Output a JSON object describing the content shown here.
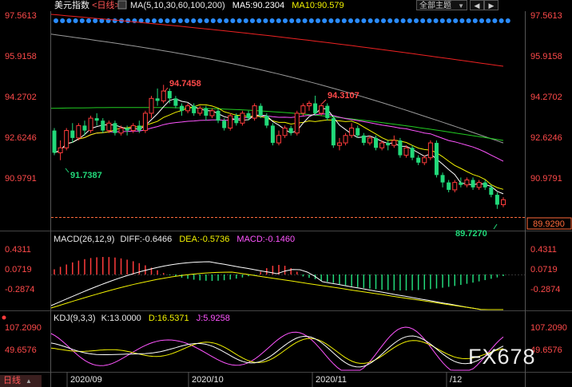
{
  "header": {
    "symbol": "美元指数",
    "period": "<日线>",
    "ma_params": "MA(5,10,30,60,100,200)",
    "ma5": "MA5:90.2304",
    "ma10": "MA10:90.579",
    "all_indicators": "全部主题",
    "nav_prev": "◀",
    "nav_next": "▶"
  },
  "colors": {
    "up": "#ff3b3b",
    "down": "#22d97a",
    "ma5": "#ffffff",
    "ma10": "#f2f200",
    "ma30": "#ff55ff",
    "ma60": "#22cc22",
    "ma100": "#9a9a9a",
    "ma200": "#ee2222"
  },
  "price_axis": {
    "left_labels": [
      "97.5613",
      "95.9158",
      "94.2702",
      "92.6246",
      "90.9791"
    ],
    "right_labels": [
      "97.5613",
      "95.9158",
      "94.2702",
      "92.6246",
      "90.9791"
    ],
    "current_price": "89.9290"
  },
  "annotations": {
    "high_1": "94.7458",
    "high_2": "94.3107",
    "low_1": "91.7387",
    "low_2": "89.7270"
  },
  "macd": {
    "title": "MACD(26,12,9)",
    "diff": "DIFF:-0.6466",
    "dea": "DEA:-0.5736",
    "macd": "MACD:-0.1460",
    "axis_labels": [
      "0.4311",
      "0.0719",
      "-0.2874"
    ]
  },
  "kdj": {
    "title": "KDJ(9,3,3)",
    "k": "K:13.0000",
    "d": "D:16.5371",
    "j": "J:5.9258",
    "axis_labels": [
      "107.2090",
      "49.6576"
    ]
  },
  "time_axis": {
    "labels": [
      "2020/09",
      "2020/10",
      "2020/11",
      "/12"
    ]
  },
  "footer": {
    "period_tab": "日线"
  },
  "watermark": "FX678",
  "chart_data": {
    "type": "candlestick",
    "price_range": [
      89.4,
      97.6
    ],
    "series": [
      {
        "name": "MA5",
        "value": 90.2304
      },
      {
        "name": "MA10",
        "value": 90.579
      }
    ],
    "candles": [
      [
        92.9,
        92.0,
        93.0,
        91.9
      ],
      [
        92.0,
        92.2,
        92.5,
        91.7
      ],
      [
        92.2,
        92.9,
        93.0,
        92.1
      ],
      [
        92.9,
        92.6,
        93.2,
        92.4
      ],
      [
        92.6,
        93.1,
        93.2,
        92.5
      ],
      [
        93.1,
        92.9,
        93.3,
        92.7
      ],
      [
        92.9,
        93.4,
        93.5,
        92.8
      ],
      [
        93.4,
        93.3,
        93.6,
        93.1
      ],
      [
        93.3,
        92.9,
        93.4,
        92.8
      ],
      [
        92.9,
        93.2,
        93.3,
        92.8
      ],
      [
        93.2,
        92.8,
        93.3,
        92.7
      ],
      [
        92.8,
        93.0,
        93.1,
        92.7
      ],
      [
        93.0,
        92.9,
        93.1,
        92.7
      ],
      [
        92.9,
        93.1,
        93.2,
        92.8
      ],
      [
        93.1,
        92.9,
        93.3,
        92.8
      ],
      [
        92.9,
        93.6,
        93.7,
        92.8
      ],
      [
        93.6,
        94.2,
        94.3,
        93.4
      ],
      [
        94.2,
        94.1,
        94.6,
        93.9
      ],
      [
        94.1,
        94.5,
        94.75,
        94.0
      ],
      [
        94.5,
        94.2,
        94.6,
        94.0
      ],
      [
        94.2,
        93.9,
        94.3,
        93.8
      ],
      [
        93.9,
        93.7,
        94.0,
        93.5
      ],
      [
        93.7,
        93.9,
        94.0,
        93.6
      ],
      [
        93.9,
        93.6,
        94.0,
        93.5
      ],
      [
        93.6,
        93.8,
        93.9,
        93.5
      ],
      [
        93.8,
        93.5,
        93.9,
        93.3
      ],
      [
        93.5,
        93.7,
        93.8,
        93.4
      ],
      [
        93.7,
        93.3,
        93.8,
        93.2
      ],
      [
        93.3,
        93.0,
        93.4,
        92.9
      ],
      [
        93.0,
        93.5,
        93.6,
        92.9
      ],
      [
        93.5,
        93.2,
        93.6,
        93.1
      ],
      [
        93.2,
        93.6,
        93.7,
        93.1
      ],
      [
        93.6,
        93.4,
        93.7,
        93.3
      ],
      [
        93.4,
        93.9,
        94.0,
        93.3
      ],
      [
        93.9,
        93.5,
        94.0,
        93.4
      ],
      [
        93.5,
        93.1,
        93.6,
        93.0
      ],
      [
        93.1,
        92.4,
        93.2,
        92.3
      ],
      [
        92.4,
        92.7,
        92.9,
        92.3
      ],
      [
        92.7,
        93.0,
        93.1,
        92.6
      ],
      [
        93.0,
        92.8,
        93.1,
        92.7
      ],
      [
        92.8,
        93.6,
        93.7,
        92.7
      ],
      [
        93.6,
        93.9,
        94.0,
        93.5
      ],
      [
        93.9,
        94.0,
        94.1,
        93.7
      ],
      [
        94.0,
        93.6,
        94.31,
        93.5
      ],
      [
        93.6,
        93.9,
        94.0,
        93.5
      ],
      [
        93.9,
        93.4,
        94.0,
        93.3
      ],
      [
        93.4,
        92.3,
        93.5,
        92.2
      ],
      [
        92.3,
        92.4,
        92.6,
        92.1
      ],
      [
        92.4,
        92.7,
        92.8,
        92.3
      ],
      [
        92.7,
        93.0,
        93.2,
        92.6
      ],
      [
        93.0,
        92.7,
        93.1,
        92.6
      ],
      [
        92.7,
        92.4,
        92.8,
        92.3
      ],
      [
        92.4,
        92.6,
        92.7,
        92.3
      ],
      [
        92.6,
        92.2,
        92.7,
        92.1
      ],
      [
        92.2,
        92.4,
        92.5,
        92.1
      ],
      [
        92.4,
        92.3,
        92.5,
        92.1
      ],
      [
        92.3,
        92.5,
        92.7,
        92.2
      ],
      [
        92.5,
        91.9,
        92.6,
        91.8
      ],
      [
        91.9,
        92.2,
        92.3,
        91.8
      ],
      [
        92.2,
        91.8,
        92.3,
        91.7
      ],
      [
        91.8,
        91.6,
        91.9,
        91.5
      ],
      [
        91.6,
        91.8,
        91.9,
        91.5
      ],
      [
        91.8,
        92.4,
        92.5,
        91.7
      ],
      [
        92.4,
        91.1,
        92.5,
        91.0
      ],
      [
        91.1,
        90.8,
        91.2,
        90.6
      ],
      [
        90.8,
        90.5,
        90.9,
        90.4
      ],
      [
        90.5,
        90.8,
        90.9,
        90.4
      ],
      [
        90.8,
        90.7,
        91.0,
        90.6
      ],
      [
        90.7,
        90.9,
        91.0,
        90.6
      ],
      [
        90.9,
        90.6,
        91.0,
        90.5
      ],
      [
        90.6,
        90.8,
        90.9,
        90.5
      ],
      [
        90.8,
        90.6,
        90.9,
        90.5
      ],
      [
        90.6,
        90.3,
        90.7,
        90.2
      ],
      [
        90.3,
        89.9,
        90.4,
        89.73
      ],
      [
        89.9,
        90.1,
        90.2,
        89.8
      ]
    ]
  }
}
